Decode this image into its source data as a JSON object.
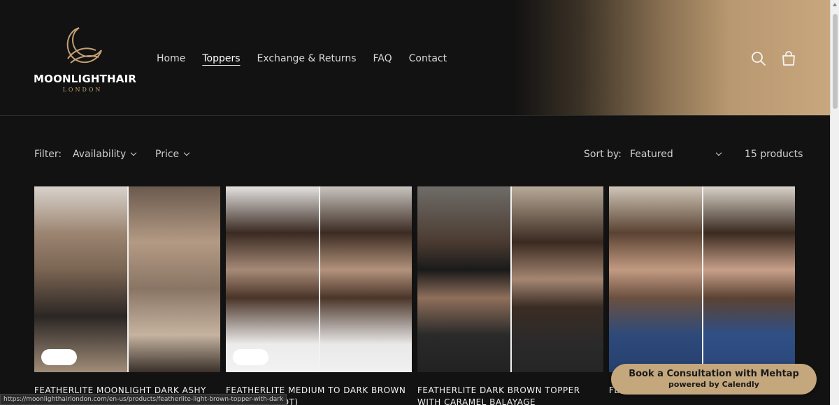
{
  "brand": {
    "name": "MOONLIGHTHAIR",
    "subtitle": "LONDON"
  },
  "nav": [
    {
      "label": "Home",
      "active": false
    },
    {
      "label": "Toppers",
      "active": true
    },
    {
      "label": "Exchange & Returns",
      "active": false
    },
    {
      "label": "FAQ",
      "active": false
    },
    {
      "label": "Contact",
      "active": false
    }
  ],
  "header_icons": {
    "search": "search-icon",
    "cart": "cart-icon"
  },
  "filters": {
    "label": "Filter:",
    "availability": "Availability",
    "price": "Price",
    "sort_label": "Sort by:",
    "sort_value": "Featured",
    "count": "15 products"
  },
  "products": [
    {
      "title": "FEATHERLITE MOONLIGHT DARK ASHY"
    },
    {
      "title": "FEATHERLITE MEDIUM TO DARK BROWN (Darker Root)"
    },
    {
      "title": "FEATHERLITE DARK BROWN TOPPER WITH CARAMEL BALAYAGE"
    },
    {
      "title": "FEATHERLITE ... DARK ROOT"
    }
  ],
  "status_url": "https://moonlighthairlondon.com/en-us/products/featherlite-light-brown-topper-with-dark",
  "calendly": {
    "title": "Book a Consultation with Mehtap",
    "subtitle": "powered by Calendly"
  },
  "colors": {
    "background": "#121212",
    "accent_gold": "#c4a77d",
    "text": "#e6e6e6"
  }
}
